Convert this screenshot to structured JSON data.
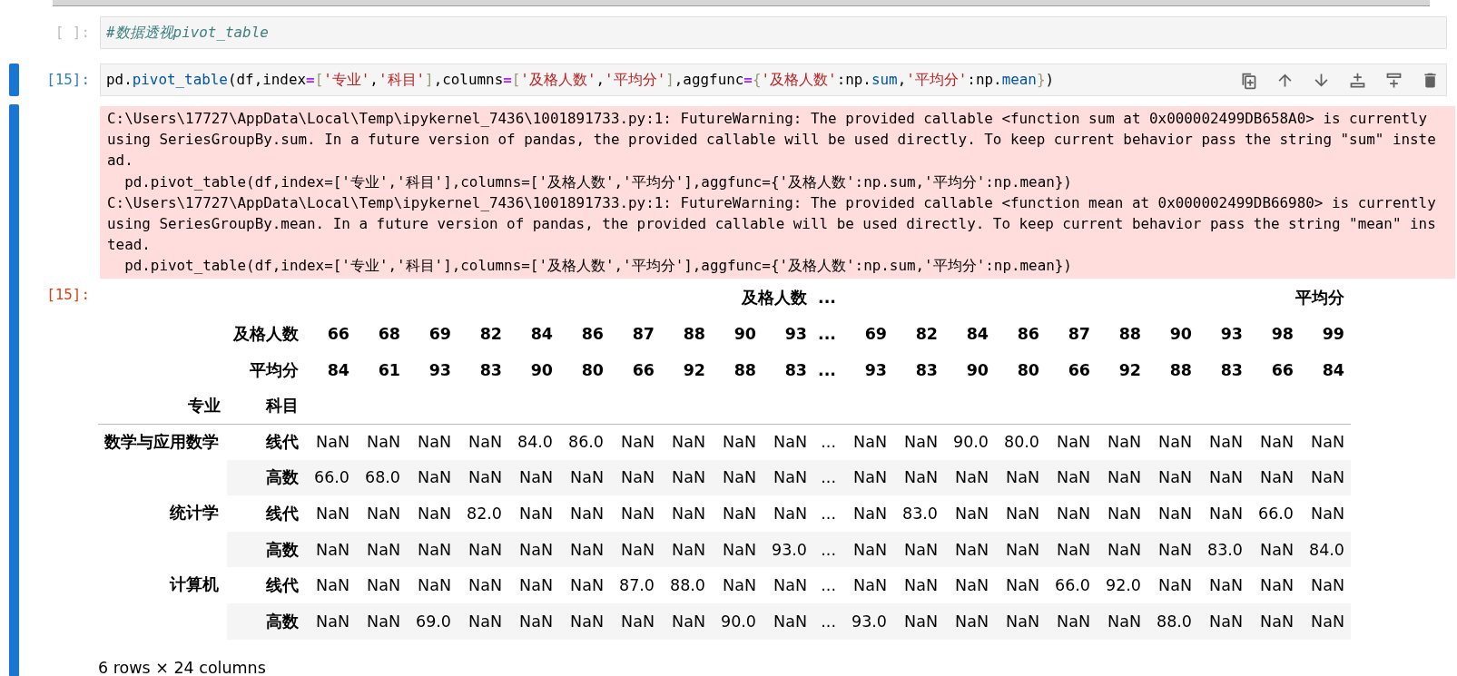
{
  "cells": [
    {
      "prompt": "[ ]:",
      "selected": false,
      "code": [
        {
          "kind": "comment",
          "text": "#数据透视pivot_table"
        }
      ]
    },
    {
      "prompt": "[15]:",
      "selected": true,
      "code": [
        {
          "kind": "plain",
          "text": "pd."
        },
        {
          "kind": "property",
          "text": "pivot_table"
        },
        {
          "kind": "plain",
          "text": "(df,index"
        },
        {
          "kind": "operator",
          "text": "="
        },
        {
          "kind": "bracket",
          "text": "["
        },
        {
          "kind": "string",
          "text": "'专业'"
        },
        {
          "kind": "plain",
          "text": ","
        },
        {
          "kind": "string",
          "text": "'科目'"
        },
        {
          "kind": "bracket",
          "text": "]"
        },
        {
          "kind": "plain",
          "text": ",columns"
        },
        {
          "kind": "operator",
          "text": "="
        },
        {
          "kind": "bracket",
          "text": "["
        },
        {
          "kind": "string",
          "text": "'及格人数'"
        },
        {
          "kind": "plain",
          "text": ","
        },
        {
          "kind": "string",
          "text": "'平均分'"
        },
        {
          "kind": "bracket",
          "text": "]"
        },
        {
          "kind": "plain",
          "text": ",aggfunc"
        },
        {
          "kind": "operator",
          "text": "="
        },
        {
          "kind": "bracket",
          "text": "{"
        },
        {
          "kind": "string",
          "text": "'及格人数'"
        },
        {
          "kind": "plain",
          "text": ":np."
        },
        {
          "kind": "property",
          "text": "sum"
        },
        {
          "kind": "plain",
          "text": ","
        },
        {
          "kind": "string",
          "text": "'平均分'"
        },
        {
          "kind": "plain",
          "text": ":np."
        },
        {
          "kind": "property",
          "text": "mean"
        },
        {
          "kind": "bracket",
          "text": "}"
        },
        {
          "kind": "plain",
          "text": ")"
        }
      ],
      "outputs": [
        {
          "kind": "stderr",
          "lines": [
            "C:\\Users\\17727\\AppData\\Local\\Temp\\ipykernel_7436\\1001891733.py:1: FutureWarning: The provided callable <function sum at 0x000002499DB658A0> is currently",
            "using SeriesGroupBy.sum. In a future version of pandas, the provided callable will be used directly. To keep current behavior pass the string \"sum\" inste",
            "ad.",
            "  pd.pivot_table(df,index=['专业','科目'],columns=['及格人数','平均分'],aggfunc={'及格人数':np.sum,'平均分':np.mean})",
            "C:\\Users\\17727\\AppData\\Local\\Temp\\ipykernel_7436\\1001891733.py:1: FutureWarning: The provided callable <function mean at 0x000002499DB66980> is currently",
            "using SeriesGroupBy.mean. In a future version of pandas, the provided callable will be used directly. To keep current behavior pass the string \"mean\" ins",
            "tead.",
            "  pd.pivot_table(df,index=['专业','科目'],columns=['及格人数','平均分'],aggfunc={'及格人数':np.sum,'平均分':np.mean})"
          ]
        },
        {
          "kind": "dataframe",
          "prompt": "[15]:",
          "column_groups": [
            {
              "label": "及格人数",
              "columns": [
                [
                  "66",
                  "84"
                ],
                [
                  "68",
                  "61"
                ],
                [
                  "69",
                  "93"
                ],
                [
                  "82",
                  "83"
                ],
                [
                  "84",
                  "90"
                ],
                [
                  "86",
                  "80"
                ],
                [
                  "87",
                  "66"
                ],
                [
                  "88",
                  "92"
                ],
                [
                  "90",
                  "88"
                ],
                [
                  "93",
                  "83"
                ]
              ]
            },
            {
              "label": "...",
              "columns": [
                [
                  "...",
                  "..."
                ]
              ]
            },
            {
              "label": "平均分",
              "columns": [
                [
                  "69",
                  "93"
                ],
                [
                  "82",
                  "83"
                ],
                [
                  "84",
                  "90"
                ],
                [
                  "86",
                  "80"
                ],
                [
                  "87",
                  "66"
                ],
                [
                  "88",
                  "92"
                ],
                [
                  "90",
                  "88"
                ],
                [
                  "93",
                  "83"
                ],
                [
                  "98",
                  "66"
                ],
                [
                  "99",
                  "84"
                ]
              ]
            }
          ],
          "column_level_names": [
            "及格人数",
            "平均分"
          ],
          "index_names": [
            "专业",
            "科目"
          ],
          "row_groups": [
            {
              "label": "数学与应用数学",
              "rows": [
                {
                  "label": "线代",
                  "values": [
                    "NaN",
                    "NaN",
                    "NaN",
                    "NaN",
                    "84.0",
                    "86.0",
                    "NaN",
                    "NaN",
                    "NaN",
                    "NaN",
                    "...",
                    "NaN",
                    "NaN",
                    "90.0",
                    "80.0",
                    "NaN",
                    "NaN",
                    "NaN",
                    "NaN",
                    "NaN",
                    "NaN"
                  ]
                },
                {
                  "label": "高数",
                  "values": [
                    "66.0",
                    "68.0",
                    "NaN",
                    "NaN",
                    "NaN",
                    "NaN",
                    "NaN",
                    "NaN",
                    "NaN",
                    "NaN",
                    "...",
                    "NaN",
                    "NaN",
                    "NaN",
                    "NaN",
                    "NaN",
                    "NaN",
                    "NaN",
                    "NaN",
                    "NaN",
                    "NaN"
                  ]
                }
              ]
            },
            {
              "label": "统计学",
              "rows": [
                {
                  "label": "线代",
                  "values": [
                    "NaN",
                    "NaN",
                    "NaN",
                    "82.0",
                    "NaN",
                    "NaN",
                    "NaN",
                    "NaN",
                    "NaN",
                    "NaN",
                    "...",
                    "NaN",
                    "83.0",
                    "NaN",
                    "NaN",
                    "NaN",
                    "NaN",
                    "NaN",
                    "NaN",
                    "66.0",
                    "NaN"
                  ]
                },
                {
                  "label": "高数",
                  "values": [
                    "NaN",
                    "NaN",
                    "NaN",
                    "NaN",
                    "NaN",
                    "NaN",
                    "NaN",
                    "NaN",
                    "NaN",
                    "93.0",
                    "...",
                    "NaN",
                    "NaN",
                    "NaN",
                    "NaN",
                    "NaN",
                    "NaN",
                    "NaN",
                    "83.0",
                    "NaN",
                    "84.0"
                  ]
                }
              ]
            },
            {
              "label": "计算机",
              "rows": [
                {
                  "label": "线代",
                  "values": [
                    "NaN",
                    "NaN",
                    "NaN",
                    "NaN",
                    "NaN",
                    "NaN",
                    "87.0",
                    "88.0",
                    "NaN",
                    "NaN",
                    "...",
                    "NaN",
                    "NaN",
                    "NaN",
                    "NaN",
                    "66.0",
                    "92.0",
                    "NaN",
                    "NaN",
                    "NaN",
                    "NaN"
                  ]
                },
                {
                  "label": "高数",
                  "values": [
                    "NaN",
                    "NaN",
                    "69.0",
                    "NaN",
                    "NaN",
                    "NaN",
                    "NaN",
                    "NaN",
                    "90.0",
                    "NaN",
                    "...",
                    "93.0",
                    "NaN",
                    "NaN",
                    "NaN",
                    "NaN",
                    "NaN",
                    "88.0",
                    "NaN",
                    "NaN",
                    "NaN"
                  ]
                }
              ]
            }
          ],
          "footer": "6 rows × 24 columns"
        }
      ]
    }
  ]
}
